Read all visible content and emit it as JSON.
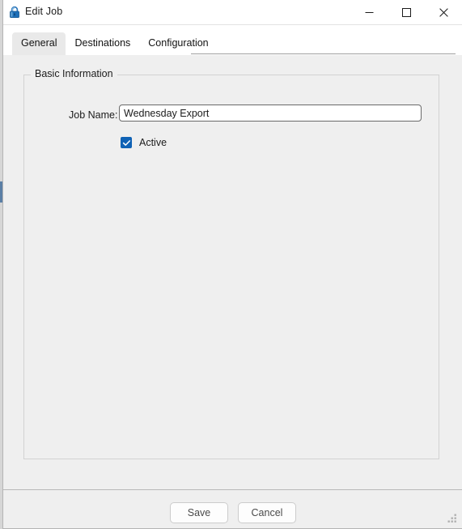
{
  "window": {
    "title": "Edit Job",
    "icon": "lock-icon",
    "controls": {
      "minimize": "minimize-icon",
      "maximize": "maximize-icon",
      "close": "close-icon"
    }
  },
  "tabs": [
    {
      "label": "General",
      "selected": true
    },
    {
      "label": "Destinations",
      "selected": false
    },
    {
      "label": "Configuration",
      "selected": false
    }
  ],
  "general_tab": {
    "group": {
      "legend": "Basic Information"
    },
    "job_name": {
      "label": "Job Name:",
      "value": "Wednesday Export",
      "placeholder": ""
    },
    "active": {
      "label": "Active",
      "checked": true
    }
  },
  "footer": {
    "save_label": "Save",
    "cancel_label": "Cancel"
  },
  "colors": {
    "accent": "#0f62b5",
    "title_bar": "#ffffff",
    "content_bg": "#efefef",
    "border": "#d2d2d2",
    "lock_icon": "#1d6fb8"
  }
}
